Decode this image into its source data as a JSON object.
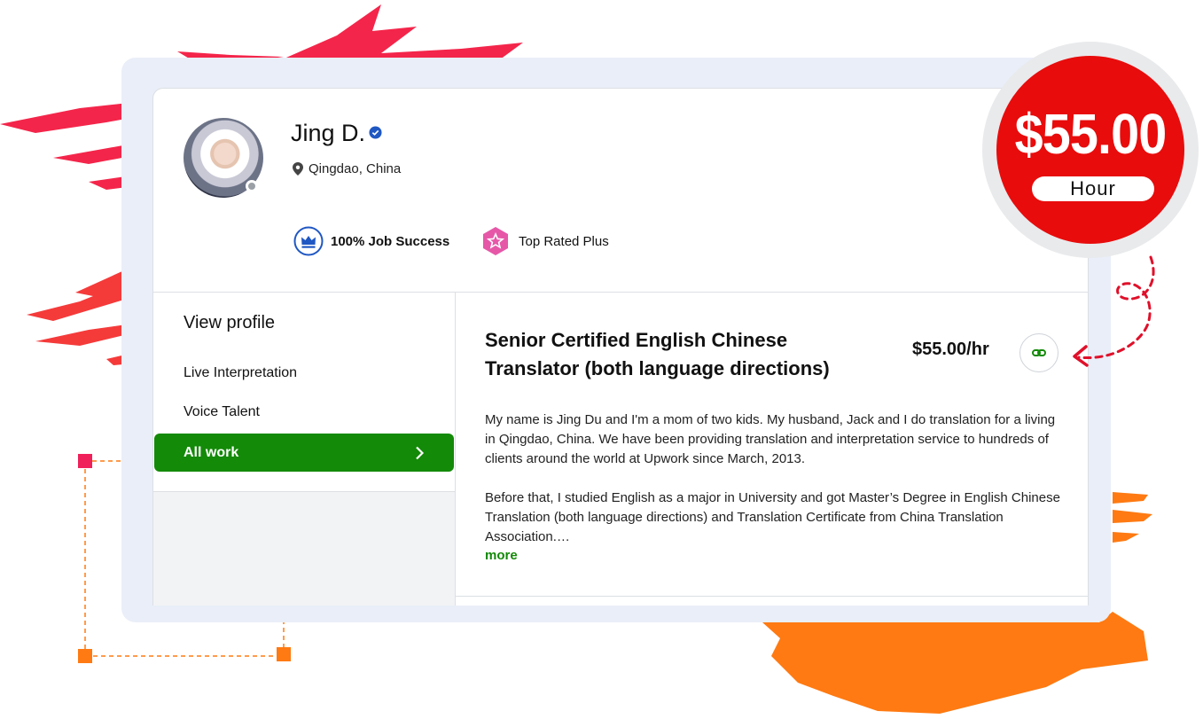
{
  "profile": {
    "name": "Jing D.",
    "location": "Qingdao, China",
    "job_success": "100% Job Success",
    "top_rated": "Top Rated Plus"
  },
  "sidebar": {
    "title": "View profile",
    "items": [
      {
        "label": "Live Interpretation"
      },
      {
        "label": "Voice Talent"
      },
      {
        "label": "All work"
      }
    ]
  },
  "main": {
    "title": "Senior Certified English Chinese Translator (both language directions)",
    "rate": "$55.00/hr",
    "paragraphs": [
      "My name is Jing Du and I'm a mom of two kids. My husband, Jack and I do translation for a living in Qingdao, China. We have been providing translation and interpretation service to hundreds of clients around the world at Upwork since March, 2013.",
      "Before that, I studied English as a major in University and got Master’s Degree in English Chinese Translation (both language directions) and Translation Certificate from China Translation Association.…"
    ],
    "more_label": "more"
  },
  "price_badge": {
    "amount": "$55.00",
    "unit": "Hour"
  },
  "colors": {
    "accent_green": "#138a08",
    "badge_red": "#e80c0c",
    "brush_red": "#f4254a",
    "brush_orange": "#ff7a12"
  },
  "icons": [
    "location-pin-icon",
    "verified-icon",
    "crown-icon",
    "star-badge-icon",
    "chevron-right-icon",
    "link-icon",
    "dashed-arrow-icon"
  ]
}
